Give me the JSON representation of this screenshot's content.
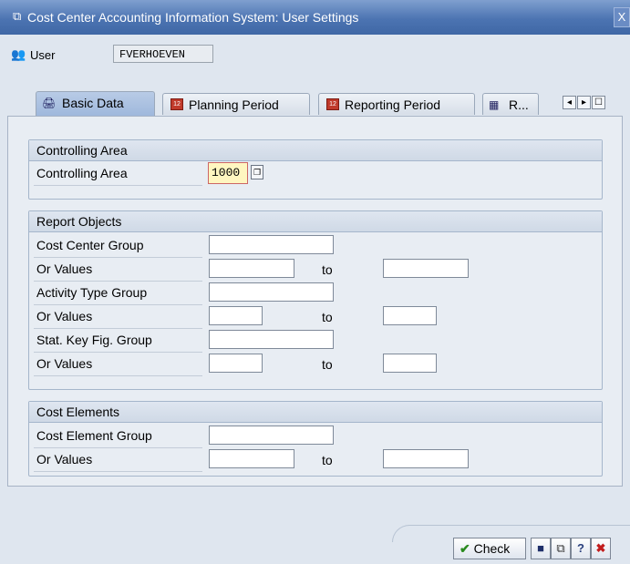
{
  "window": {
    "title": "Cost Center Accounting Information System: User Settings",
    "close_symbol": "X"
  },
  "user": {
    "label": "User",
    "value": "FVERHOEVEN"
  },
  "tabs": [
    {
      "label": "Basic Data",
      "icon": "basic-data-icon"
    },
    {
      "label": "Planning Period",
      "icon": "calendar-icon"
    },
    {
      "label": "Reporting Period",
      "icon": "calendar-icon"
    },
    {
      "label": "R...",
      "icon": "report-icon"
    }
  ],
  "tabnav": {
    "left": "◂",
    "right": "▸",
    "list": "☐"
  },
  "controlling_area": {
    "heading": "Controlling Area",
    "label": "Controlling Area",
    "value": "1000"
  },
  "report_objects": {
    "heading": "Report Objects",
    "rows": [
      {
        "label": "Cost Center Group"
      },
      {
        "label": "Or Values",
        "to": "to"
      },
      {
        "label": "Activity Type Group"
      },
      {
        "label": "Or Values",
        "to": "to"
      },
      {
        "label": "Stat. Key Fig. Group"
      },
      {
        "label": "Or Values",
        "to": "to"
      }
    ]
  },
  "cost_elements": {
    "heading": "Cost Elements",
    "rows": [
      {
        "label": "Cost Element Group"
      },
      {
        "label": "Or Values",
        "to": "to"
      }
    ]
  },
  "footer": {
    "check_label": "Check"
  }
}
